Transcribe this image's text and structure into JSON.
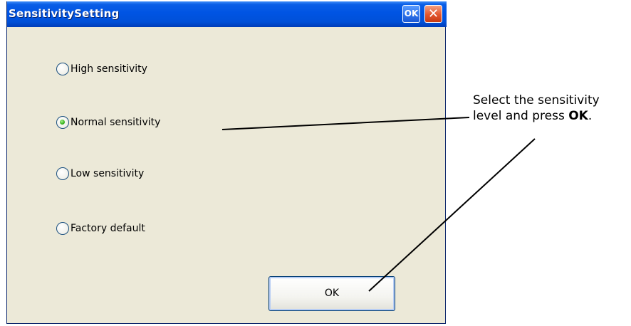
{
  "window": {
    "title": "SensitivitySetting",
    "ok_button_label": "OK",
    "close_button_label": "✕"
  },
  "options": [
    {
      "label": "High sensitivity",
      "selected": false
    },
    {
      "label": "Normal sensitivity",
      "selected": true
    },
    {
      "label": "Low sensitivity",
      "selected": false
    },
    {
      "label": "Factory default",
      "selected": false
    }
  ],
  "ok_button": {
    "label": "OK"
  },
  "callout": {
    "line1": "Select the sensitivity",
    "line2_prefix": "level and press ",
    "line2_bold": "OK",
    "line2_suffix": "."
  },
  "colors": {
    "titlebar": "#0054e3",
    "dialog_background": "#ece9d8",
    "radio_selected": "#36b21e",
    "close_button": "#e2562e"
  }
}
